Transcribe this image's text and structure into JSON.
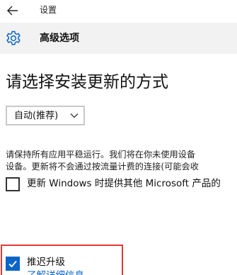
{
  "window": {
    "back_icon": "arrow-left-icon",
    "title": "设置"
  },
  "header": {
    "icon": "gear-icon",
    "title": "高级选项"
  },
  "main": {
    "heading": "请选择安装更新的方式",
    "install_mode": {
      "selected": "自动(推荐)",
      "icon": "chevron-down-icon"
    },
    "description": {
      "line1": "请保持所有应用平稳运行。我们将在你未使用设备",
      "line2": "设备。更新将不会通过按流量计费的连接(可能会收"
    },
    "options": [
      {
        "label": "更新 Windows 时提供其他 Microsoft 产品的",
        "checked": false
      },
      {
        "label": "推迟升级",
        "checked": true
      }
    ],
    "learn_more": "了解详细信息"
  },
  "colors": {
    "accent": "#0a65c7",
    "highlight_border": "#e53935",
    "header_band": "#f2f2f2"
  }
}
